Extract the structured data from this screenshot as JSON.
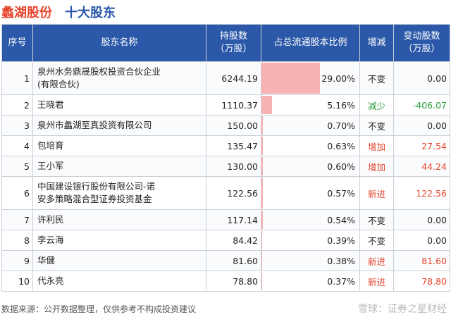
{
  "header": {
    "company": "蠡湖股份",
    "subtitle": "十大股东"
  },
  "table": {
    "columns": [
      "序号",
      "股东名称",
      "持股数\n（万股）",
      "占总流通股本比例",
      "增减",
      "变动股数\n（万股）"
    ],
    "rows": [
      {
        "idx": "1",
        "name": "泉州水务鼎晟股权投资合伙企业\n(有限合伙)",
        "shares": "6244.19",
        "pct": "29.00%",
        "pct_value": 29.0,
        "change": "不变",
        "delta": "0.00",
        "tone": ""
      },
      {
        "idx": "2",
        "name": "王晓君",
        "shares": "1110.37",
        "pct": "5.16%",
        "pct_value": 5.16,
        "change": "减少",
        "delta": "-406.07",
        "tone": "down"
      },
      {
        "idx": "3",
        "name": "泉州市蠡湖至真投资有限公司",
        "shares": "150.00",
        "pct": "0.70%",
        "pct_value": 0.7,
        "change": "不变",
        "delta": "0.00",
        "tone": ""
      },
      {
        "idx": "4",
        "name": "包培育",
        "shares": "135.47",
        "pct": "0.63%",
        "pct_value": 0.63,
        "change": "增加",
        "delta": "27.54",
        "tone": "up"
      },
      {
        "idx": "5",
        "name": "王小军",
        "shares": "130.00",
        "pct": "0.60%",
        "pct_value": 0.6,
        "change": "增加",
        "delta": "44.24",
        "tone": "up"
      },
      {
        "idx": "6",
        "name": "中国建设银行股份有限公司-诺\n安多策略混合型证券投资基金",
        "shares": "122.56",
        "pct": "0.57%",
        "pct_value": 0.57,
        "change": "新进",
        "delta": "122.56",
        "tone": "up"
      },
      {
        "idx": "7",
        "name": "许利民",
        "shares": "117.14",
        "pct": "0.54%",
        "pct_value": 0.54,
        "change": "不变",
        "delta": "0.00",
        "tone": ""
      },
      {
        "idx": "8",
        "name": "李云海",
        "shares": "84.42",
        "pct": "0.39%",
        "pct_value": 0.39,
        "change": "不变",
        "delta": "0.00",
        "tone": ""
      },
      {
        "idx": "9",
        "name": "华健",
        "shares": "81.60",
        "pct": "0.38%",
        "pct_value": 0.38,
        "change": "新进",
        "delta": "81.60",
        "tone": "up"
      },
      {
        "idx": "10",
        "name": "代永亮",
        "shares": "78.80",
        "pct": "0.37%",
        "pct_value": 0.37,
        "change": "新进",
        "delta": "78.80",
        "tone": "up"
      }
    ]
  },
  "footer": {
    "source": "数据来源：公开数据整理，仅供参考不构成投资建议",
    "brand": "雪球：证券之星财经"
  },
  "watermark": "证券之星",
  "colors": {
    "header_bg": "#2b58a8",
    "company": "#e8432c",
    "subtitle": "#2b58a8",
    "bar": "#f7b3b3",
    "up": "#e8432c",
    "down": "#2a9d3c"
  }
}
